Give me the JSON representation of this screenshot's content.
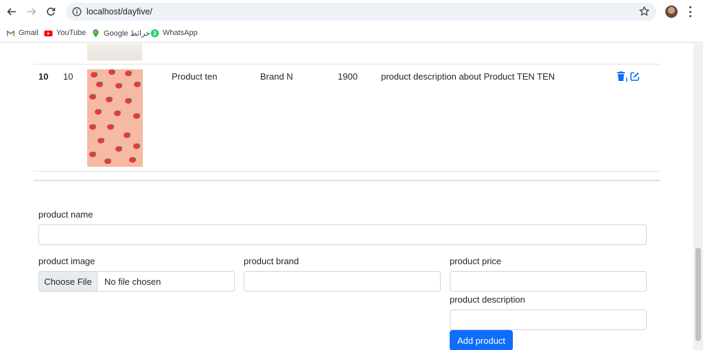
{
  "browser": {
    "url": "localhost/dayfive/",
    "bookmarks": [
      {
        "label": "Gmail",
        "icon": "gmail-icon"
      },
      {
        "label": "YouTube",
        "icon": "youtube-icon"
      },
      {
        "label": "Google خرائط",
        "icon": "google-maps-icon"
      },
      {
        "label": "WhatsApp",
        "icon": "whatsapp-icon"
      }
    ]
  },
  "table": {
    "row": {
      "index": "10",
      "id": "10",
      "name": "Product ten",
      "brand": "Brand N",
      "price": "1900",
      "description": "product description about Product TEN TEN",
      "actions": [
        "delete-icon",
        "edit-icon"
      ]
    }
  },
  "form": {
    "name_label": "product name",
    "image_label": "product image",
    "file_button": "Choose File",
    "file_status": "No file chosen",
    "brand_label": "product brand",
    "price_label": "product price",
    "description_label": "product description",
    "submit_label": "Add product"
  },
  "colors": {
    "primary": "#0d6efd",
    "border": "#ced4da",
    "text": "#212529"
  }
}
